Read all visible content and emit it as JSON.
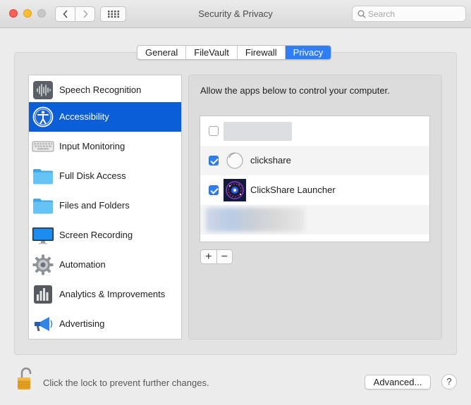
{
  "window": {
    "title": "Security & Privacy",
    "search_placeholder": "Search"
  },
  "tabs": [
    {
      "label": "General",
      "active": false
    },
    {
      "label": "FileVault",
      "active": false
    },
    {
      "label": "Firewall",
      "active": false
    },
    {
      "label": "Privacy",
      "active": true
    }
  ],
  "sidebar": {
    "items": [
      {
        "label": "Speech Recognition",
        "icon": "waveform-icon"
      },
      {
        "label": "Accessibility",
        "icon": "accessibility-icon",
        "selected": true
      },
      {
        "label": "Input Monitoring",
        "icon": "keyboard-icon"
      },
      {
        "label": "Full Disk Access",
        "icon": "folder-icon"
      },
      {
        "label": "Files and Folders",
        "icon": "folder-icon"
      },
      {
        "label": "Screen Recording",
        "icon": "monitor-icon"
      },
      {
        "label": "Automation",
        "icon": "gear-icon"
      },
      {
        "label": "Analytics & Improvements",
        "icon": "bar-chart-icon"
      },
      {
        "label": "Advertising",
        "icon": "megaphone-icon"
      }
    ]
  },
  "pane": {
    "description": "Allow the apps below to control your computer.",
    "apps": [
      {
        "name": "",
        "checked": false,
        "redacted": true
      },
      {
        "name": "clickshare",
        "checked": true
      },
      {
        "name": "ClickShare Launcher",
        "checked": true
      },
      {
        "name": "",
        "checked": false,
        "redacted": true
      }
    ],
    "add_label": "+",
    "remove_label": "−"
  },
  "footer": {
    "lock_text": "Click the lock to prevent further changes.",
    "advanced_label": "Advanced...",
    "help_label": "?"
  },
  "colors": {
    "accent": "#2f7ef6",
    "selection": "#0a5fd9"
  }
}
